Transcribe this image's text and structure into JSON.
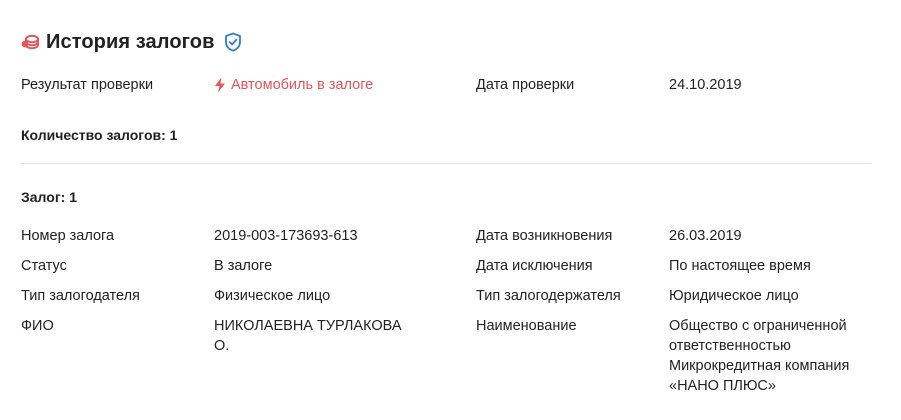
{
  "header": {
    "title": "История залогов",
    "icon": "coins-icon",
    "badge_icon": "shield-check-icon",
    "icon_color": "#e5555a",
    "badge_color": "#2f7fd0"
  },
  "check": {
    "result_label": "Результат проверки",
    "result_value": "Автомобиль в залоге",
    "result_icon": "lightning-icon",
    "result_color": "#e5555a",
    "date_label": "Дата проверки",
    "date_value": "24.10.2019"
  },
  "count_text": "Количество залогов: 1",
  "pledge": {
    "heading": "Залог: 1",
    "rows": [
      {
        "label1": "Номер залога",
        "value1": "2019-003-173693-613",
        "label2": "Дата возникновения",
        "value2": "26.03.2019"
      },
      {
        "label1": "Статус",
        "value1": "В залоге",
        "label2": "Дата исключения",
        "value2": "По настоящее время"
      },
      {
        "label1": "Тип залогодателя",
        "value1": "Физическое лицо",
        "label2": "Тип залогодержателя",
        "value2": "Юридическое лицо"
      },
      {
        "label1": "ФИО",
        "value1": "НИКОЛАЕВНА ТУРЛАКОВА О.",
        "label2": "Наименование",
        "value2": "Общество с ограниченной ответственностью Микрокредитная компания «НАНО ПЛЮС»"
      }
    ]
  }
}
